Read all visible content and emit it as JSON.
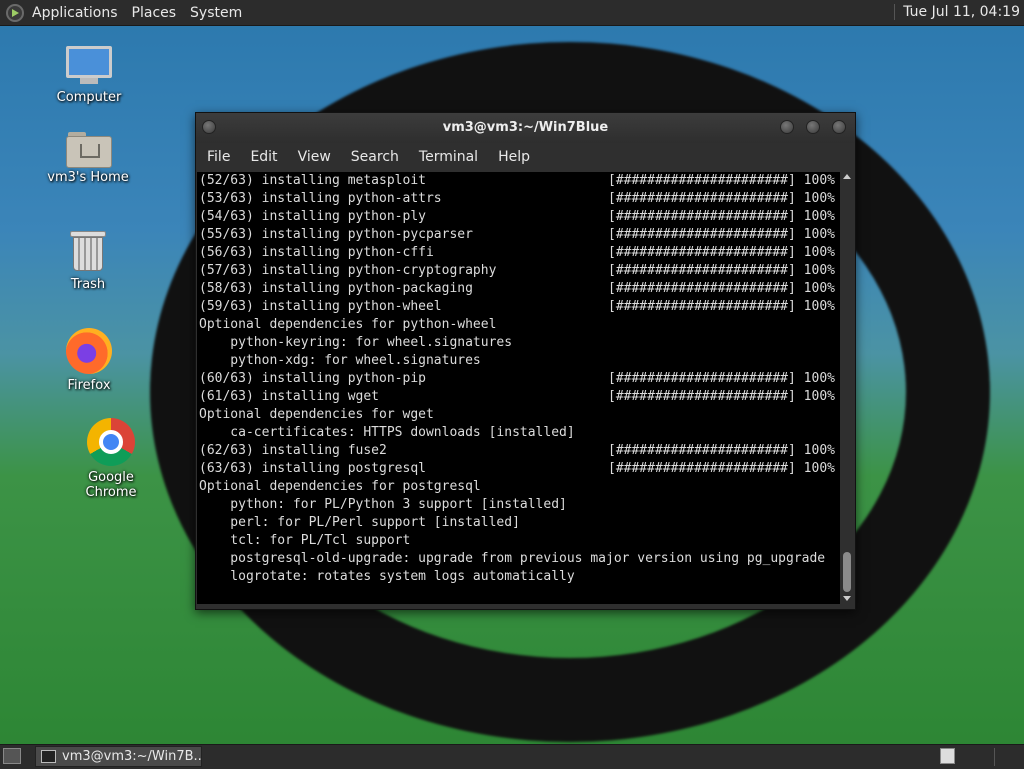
{
  "top_panel": {
    "menus": [
      "Applications",
      "Places",
      "System"
    ],
    "clock": "Tue Jul 11, 04:19"
  },
  "desktop_icons": {
    "computer": "Computer",
    "home": "vm3's Home",
    "trash": "Trash",
    "firefox": "Firefox",
    "chrome": "Google Chrome"
  },
  "terminal": {
    "title": "vm3@vm3:~/Win7Blue",
    "menu": [
      "File",
      "Edit",
      "View",
      "Search",
      "Terminal",
      "Help"
    ],
    "lines": [
      {
        "text": "(52/63) installing metasploit",
        "progress": "[######################] 100%"
      },
      {
        "text": "(53/63) installing python-attrs",
        "progress": "[######################] 100%"
      },
      {
        "text": "(54/63) installing python-ply",
        "progress": "[######################] 100%"
      },
      {
        "text": "(55/63) installing python-pycparser",
        "progress": "[######################] 100%"
      },
      {
        "text": "(56/63) installing python-cffi",
        "progress": "[######################] 100%"
      },
      {
        "text": "(57/63) installing python-cryptography",
        "progress": "[######################] 100%"
      },
      {
        "text": "(58/63) installing python-packaging",
        "progress": "[######################] 100%"
      },
      {
        "text": "(59/63) installing python-wheel",
        "progress": "[######################] 100%"
      },
      {
        "text": "Optional dependencies for python-wheel",
        "progress": ""
      },
      {
        "text": "    python-keyring: for wheel.signatures",
        "progress": ""
      },
      {
        "text": "    python-xdg: for wheel.signatures",
        "progress": ""
      },
      {
        "text": "(60/63) installing python-pip",
        "progress": "[######################] 100%"
      },
      {
        "text": "(61/63) installing wget",
        "progress": "[######################] 100%"
      },
      {
        "text": "Optional dependencies for wget",
        "progress": ""
      },
      {
        "text": "    ca-certificates: HTTPS downloads [installed]",
        "progress": ""
      },
      {
        "text": "(62/63) installing fuse2",
        "progress": "[######################] 100%"
      },
      {
        "text": "(63/63) installing postgresql",
        "progress": "[######################] 100%"
      },
      {
        "text": "Optional dependencies for postgresql",
        "progress": ""
      },
      {
        "text": "    python: for PL/Python 3 support [installed]",
        "progress": ""
      },
      {
        "text": "    perl: for PL/Perl support [installed]",
        "progress": ""
      },
      {
        "text": "    tcl: for PL/Tcl support",
        "progress": ""
      },
      {
        "text": "    postgresql-old-upgrade: upgrade from previous major version using pg_upgrade",
        "progress": ""
      },
      {
        "text": "    logrotate: rotates system logs automatically",
        "progress": ""
      }
    ]
  },
  "taskbar": {
    "task_label": "vm3@vm3:~/Win7B..."
  }
}
